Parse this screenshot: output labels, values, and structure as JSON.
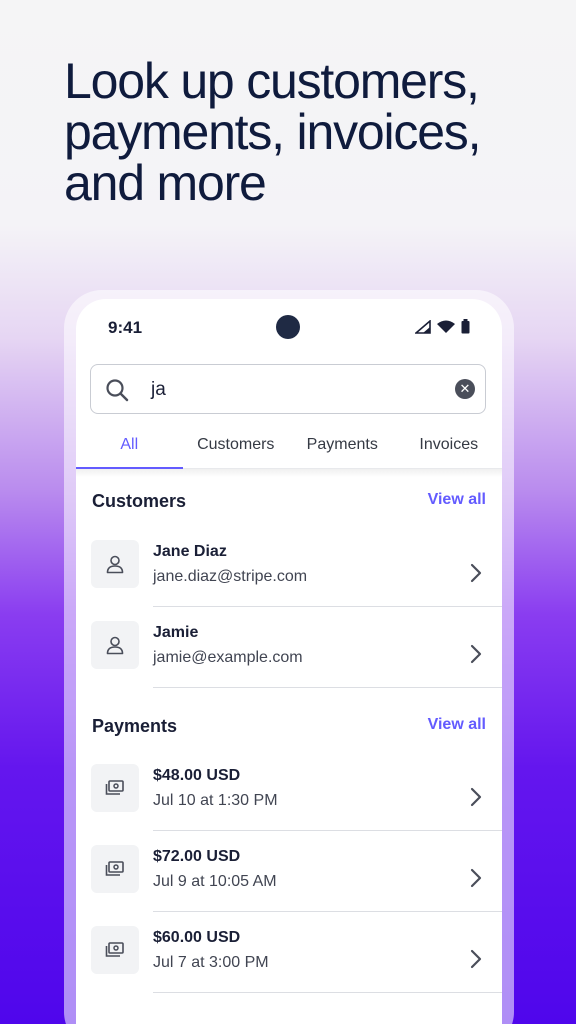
{
  "headline": {
    "line1": "Look up customers,",
    "line2": "payments, invoices,",
    "line3": "and more"
  },
  "status_bar": {
    "time": "9:41",
    "icons": [
      "signal-icon",
      "wifi-icon",
      "battery-icon"
    ]
  },
  "search": {
    "query": "ja",
    "clear_icon": "close-icon"
  },
  "tabs": [
    {
      "label": "All",
      "active": true
    },
    {
      "label": "Customers",
      "active": false
    },
    {
      "label": "Payments",
      "active": false
    },
    {
      "label": "Invoices",
      "active": false
    }
  ],
  "customers": {
    "title": "Customers",
    "view_all": "View all",
    "items": [
      {
        "name": "Jane Diaz",
        "email": "jane.diaz@stripe.com",
        "icon": "person-icon"
      },
      {
        "name": "Jamie",
        "email": "jamie@example.com",
        "icon": "person-icon"
      }
    ]
  },
  "payments": {
    "title": "Payments",
    "view_all": "View all",
    "items": [
      {
        "amount": "$48.00 USD",
        "date": "Jul 10 at 1:30 PM",
        "icon": "money-icon"
      },
      {
        "amount": "$72.00 USD",
        "date": "Jul 9 at 10:05 AM",
        "icon": "money-icon"
      },
      {
        "amount": "$60.00 USD",
        "date": "Jul 7 at 3:00 PM",
        "icon": "money-icon"
      }
    ]
  },
  "colors": {
    "accent": "#635bff",
    "text": "#1a1f36",
    "gradient_end": "#4f06ec"
  }
}
